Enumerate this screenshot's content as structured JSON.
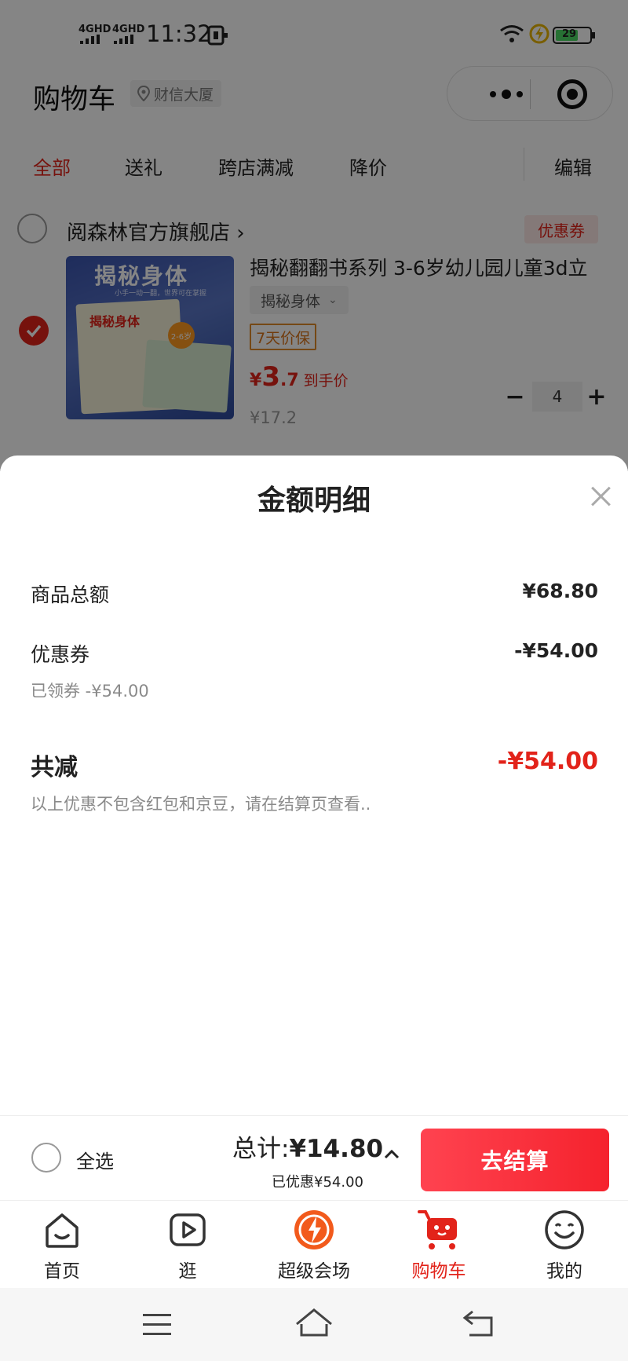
{
  "status_bar": {
    "signal_1": "4GHD",
    "signal_2": "4GHD",
    "time": "11:32",
    "battery": "29"
  },
  "header": {
    "title": "购物车",
    "location": "财信大厦"
  },
  "filters": {
    "all": "全部",
    "gift": "送礼",
    "cross_store": "跨店满减",
    "price_drop": "降价",
    "edit": "编辑"
  },
  "shop": {
    "name": "阅森林官方旗舰店",
    "coupon_tag": "优惠券"
  },
  "product": {
    "image_title": "揭秘身体",
    "image_subtitle": "小手一动一翻，世界可在掌握",
    "image_inner_title": "揭秘身体",
    "image_badge": "2-6岁",
    "title": "揭秘翻翻书系列 3-6岁幼儿园儿童3d立",
    "variant": "揭秘身体",
    "warranty": "7天价保",
    "price_currency": "¥",
    "price_int": "3",
    "price_dec": ".7",
    "price_label": "到手价",
    "original_price": "¥17.2",
    "quantity": "4"
  },
  "sheet": {
    "title": "金额明细",
    "goods_total_label": "商品总额",
    "goods_total_value": "¥68.80",
    "coupon_label": "优惠券",
    "coupon_value": "-¥54.00",
    "coupon_detail": "已领券 -¥54.00",
    "total_reduce_label": "共减",
    "total_reduce_value": "-¥54.00",
    "note": "以上优惠不包含红包和京豆，请在结算页查看.."
  },
  "checkout": {
    "select_all": "全选",
    "total_prefix": "总计:",
    "total_amount": "¥14.80",
    "saved": "已优惠¥54.00",
    "button": "去结算"
  },
  "tabbar": {
    "home": "首页",
    "browse": "逛",
    "venue": "超级会场",
    "cart": "购物车",
    "mine": "我的"
  },
  "colors": {
    "accent": "#e2231a",
    "button": "#f5222d"
  }
}
